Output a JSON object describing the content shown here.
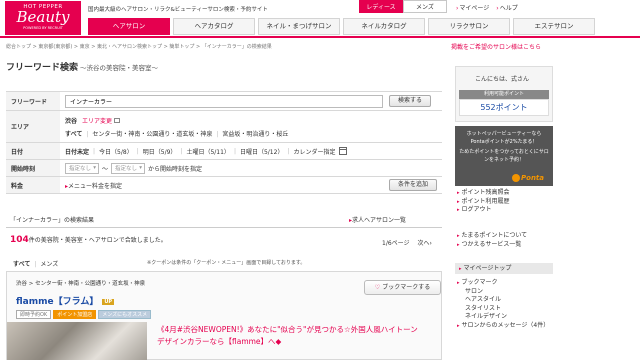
{
  "header": {
    "logo_top": "HOT PEPPER",
    "logo_main": "Beauty",
    "logo_sub": "POWERED BY RECRUIT",
    "tagline": "国内最大級のヘアサロン・リラク&ビューティーサロン検索・予約サイト",
    "gender_tabs": [
      "レディース",
      "メンズ"
    ],
    "top_links": [
      "マイページ",
      "ヘルプ"
    ],
    "nav_tabs": [
      "ヘアサロン",
      "ヘアカタログ",
      "ネイル・まつげサロン",
      "ネイルカタログ",
      "リラクサロン",
      "エステサロン"
    ],
    "accent_color": "#e5004f"
  },
  "breadcrumb": "総合トップ > 東京都(東京都) > 東京 > 東北・ヘアサロン検索トップ > 簡単トップ > 「インナーカラー」の検索結果",
  "saved_link": "掲載をご希望のサロン様はこちら",
  "main": {
    "title": "フリーワード検索",
    "subtitle": "～渋谷の美容院・美容室～",
    "form": {
      "keyword_label": "フリーワード",
      "keyword_value": "インナーカラー",
      "search_button": "検索する",
      "area_label": "エリア",
      "area_current": "渋谷",
      "area_change": "エリア変更",
      "area_options": [
        "すべて",
        "センター街・神南・公園通り・道玄坂・神泉",
        "宮益坂・明治通り・桜丘"
      ],
      "date_label": "日付",
      "date_unspecified": "日付未定",
      "date_options": [
        "今日（5/8）",
        "明日（5/9）",
        "土曜日（5/11）",
        "日曜日（5/12）",
        "カレンダー指定"
      ],
      "start_label": "開始時刻",
      "start_from": "指定なし",
      "start_to": "指定なし",
      "start_text": "から開始時刻を指定",
      "price_label": "料金",
      "price_link": "メニュー料金を指定",
      "add_button": "条件を追加"
    },
    "results_title": "「インナーカラー」の検索結果",
    "job_link": "求人ヘアサロン一覧",
    "count_number": "104",
    "count_text": "件の美容院・美容室・ヘアサロンで合致しました。",
    "paging_text": "1/6ページ",
    "paging_next": "次へ",
    "filter_tabs": [
      "すべて",
      "メンズ"
    ],
    "coupon_note": "※クーポンは条件の「クーポン・メニュー」画面で目録しております。"
  },
  "salon": {
    "area": "渋谷 > センター街・神南・公園通り・道玄坂・神泉",
    "name": "flamme【フラム】",
    "badge": "UP",
    "tags": [
      "即時予約OK",
      "ポイント加盟店",
      "メンズにもオススメ"
    ],
    "bookmark": "ブックマークする",
    "catch_line1": "《4月#渋谷NEWOPEN!》あなたに\"似合う\"が見つかる☆外国人風ハイトーン",
    "catch_line2": "デザインカラーなら【flamme】へ◆"
  },
  "sidebar": {
    "greeting": "こんにちは、式さん",
    "points_label": "利用可能ポイント",
    "points_value": "552ポイント",
    "ponta_text1": "ホットペッパービューティーなら",
    "ponta_text2": "Pontaポイントが2%たまる！",
    "ponta_text3": "ためたポイントをつかっておとくにサロンをネット予約！",
    "ponta_logo": "Ponta",
    "links_group1": [
      "ポイント残高照会",
      "ポイント利用履歴",
      "ログアウト"
    ],
    "links_group2": [
      "たまるポイントについて",
      "つかえるサービス一覧"
    ],
    "mypage_title": "マイページトップ",
    "mypage_links": [
      "ブックマーク",
      "サロン",
      "ヘアスタイル",
      "スタイリスト",
      "ネイルデザイン",
      "サロンからのメッセージ（4件）"
    ]
  }
}
